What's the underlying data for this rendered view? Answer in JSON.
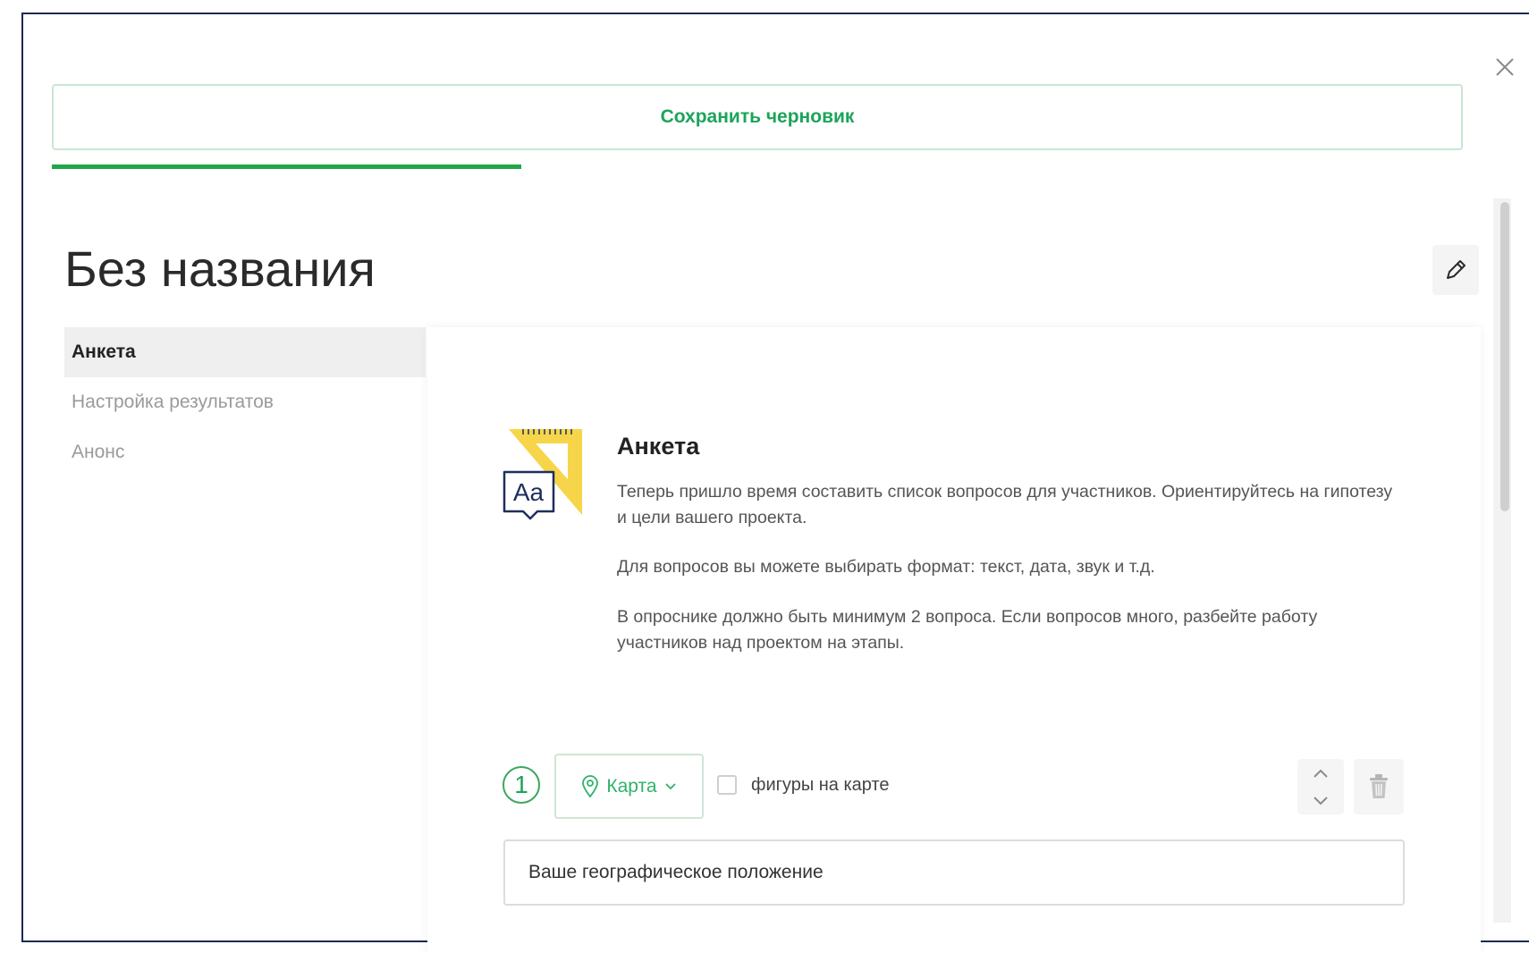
{
  "header": {
    "save_draft_label": "Сохранить черновик",
    "progress_fraction": 0.333
  },
  "page": {
    "title": "Без названия"
  },
  "sidebar": {
    "items": [
      {
        "label": "Анкета",
        "active": true
      },
      {
        "label": "Настройка результатов",
        "active": false
      },
      {
        "label": "Анонс",
        "active": false
      }
    ]
  },
  "intro": {
    "icon_label": "Аa",
    "title": "Анкета",
    "paragraphs": [
      "Теперь пришло время составить список вопросов для участников. Ориентируйтесь на гипотезу и цели вашего проекта.",
      "Для вопросов вы можете выбирать формат: текст, дата, звук и т.д.",
      "В опроснике должно быть минимум 2 вопроса. Если вопросов много, разбейте работу участников над проектом на этапы."
    ]
  },
  "question": {
    "number": "1",
    "type_label": "Карта",
    "checkbox_label": "фигуры на карте",
    "checkbox_checked": false,
    "text": "Ваше географическое положение"
  },
  "colors": {
    "accent": "#1ba45a",
    "progress": "#21a548",
    "frame_border": "#1b2a52",
    "icon_yellow": "#f6d54a",
    "icon_navy": "#1f2f5c"
  },
  "icons": {
    "close": "close-icon",
    "edit": "pencil-icon",
    "type": "map-pin-icon",
    "dropdown": "chevron-down-icon",
    "move_up": "chevron-up-icon",
    "move_down": "chevron-down-icon",
    "delete": "trash-icon",
    "intro": "ruler-text-icon"
  }
}
